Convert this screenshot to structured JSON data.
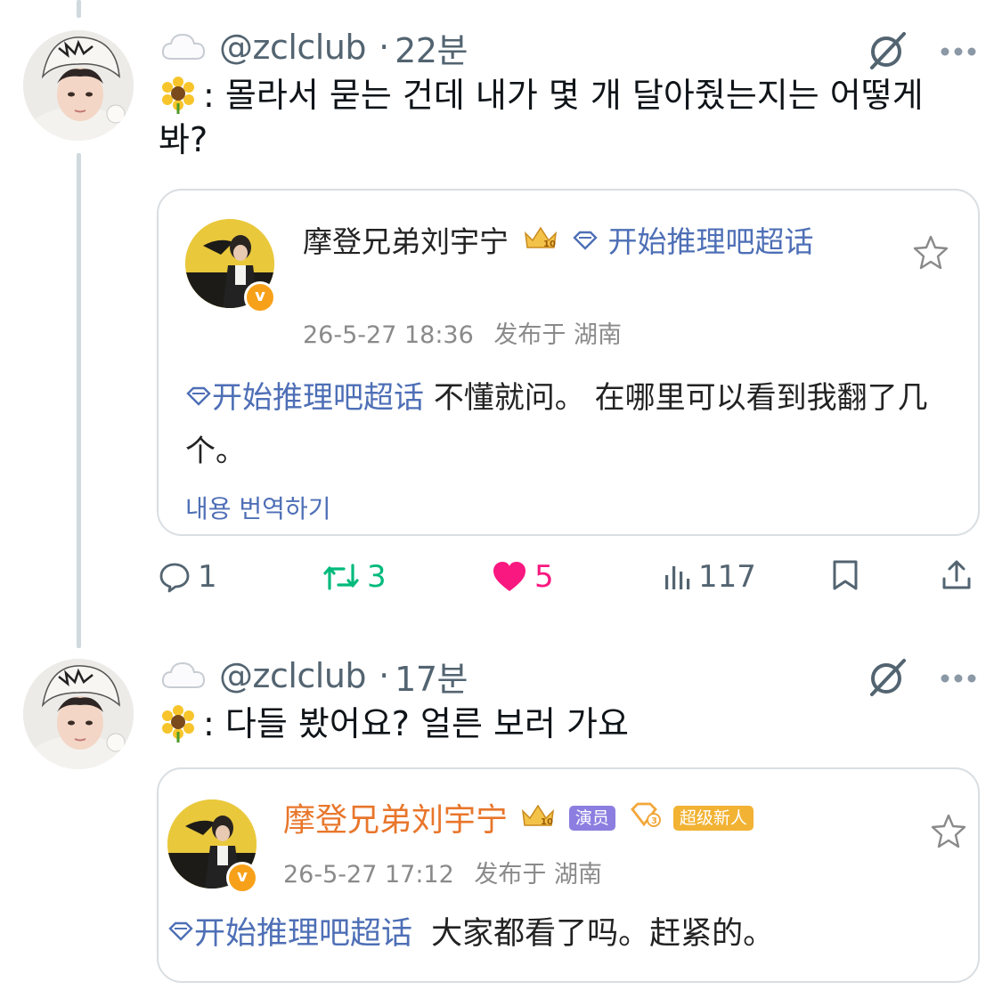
{
  "tweets": [
    {
      "handle": "@zclclub",
      "time": "22분",
      "text_prefix": ":",
      "text": "몰라서 묻는 건데 내가 몇 개 달아줬는지는 어떻게 봐?",
      "card": {
        "name": "摩登兄弟刘宇宁",
        "topic_inline": "开始推理吧超话",
        "datetime": "26-5-27 18:36",
        "location": "发布于 湖南",
        "body_topic": "开始推理吧超话",
        "body": "不懂就问。 在哪里可以看到我翻了几个。",
        "translate": "내용 번역하기",
        "crown_badge": "10"
      },
      "actions": {
        "replies": "1",
        "retweets": "3",
        "likes": "5",
        "views": "117"
      }
    },
    {
      "handle": "@zclclub",
      "time": "17분",
      "text_prefix": ":",
      "text": "다들 봤어요? 얼른 보러 가요",
      "card": {
        "name": "摩登兄弟刘宇宁",
        "tag_actor": "演员",
        "tag_level": "3",
        "tag_fan": "超级新人",
        "datetime": "26-5-27 17:12",
        "location": "发布于 湖南",
        "body_topic": "开始推理吧超话",
        "body": "大家都看了吗。赶紧的。",
        "crown_badge": "10"
      }
    }
  ],
  "colors": {
    "accent_blue": "#4e6fb6",
    "retweet_green": "#00ba7c",
    "like_pink": "#f91880",
    "muted": "#536471",
    "name_orange": "#e8762b"
  },
  "icons": {
    "cloud": "cloud-icon",
    "sunflower": "sunflower-icon",
    "grok": "grok-icon",
    "more": "more-icon",
    "star": "star-icon",
    "reply": "reply-icon",
    "retweet": "retweet-icon",
    "like": "heart-icon",
    "views": "views-icon",
    "bookmark": "bookmark-icon",
    "share": "share-icon"
  }
}
